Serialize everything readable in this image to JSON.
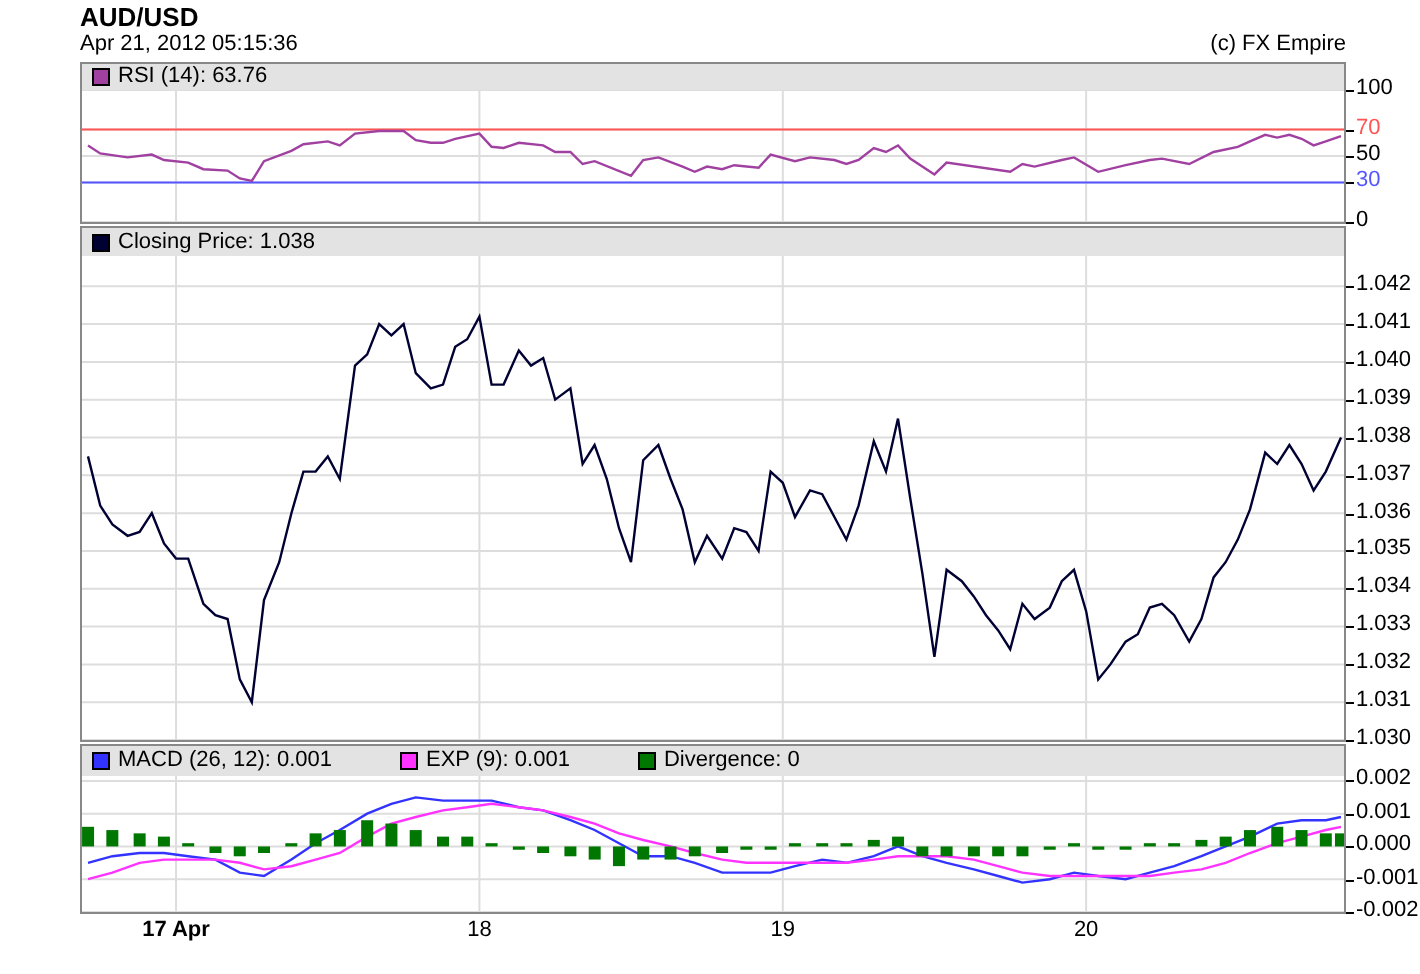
{
  "title": "AUD/USD",
  "timestamp": "Apr 21, 2012 05:15:36",
  "copyright": "(c) FX Empire",
  "panels": [
    {
      "chart_data": {
        "type": "line",
        "xlim": [
          16.69,
          20.85
        ],
        "ylim": [
          0,
          100
        ],
        "yticks": [
          0,
          30,
          50,
          70,
          100
        ],
        "grid": true,
        "legend": "top",
        "ref_lines": [
          {
            "axis": "y",
            "value": 70,
            "color": "#ff5555"
          },
          {
            "axis": "y",
            "value": 30,
            "color": "#5555ff"
          }
        ],
        "x": [
          16.71,
          16.75,
          16.84,
          16.92,
          16.96,
          17.04,
          17.09,
          17.17,
          17.21,
          17.25,
          17.29,
          17.38,
          17.42,
          17.5,
          17.54,
          17.59,
          17.67,
          17.75,
          17.79,
          17.84,
          17.88,
          17.92,
          18.0,
          18.04,
          18.08,
          18.13,
          18.21,
          18.25,
          18.3,
          18.34,
          18.38,
          18.5,
          18.54,
          18.59,
          18.67,
          18.71,
          18.75,
          18.8,
          18.84,
          18.92,
          18.96,
          19.04,
          19.09,
          19.17,
          19.21,
          19.25,
          19.3,
          19.34,
          19.38,
          19.42,
          19.5,
          19.54,
          19.75,
          19.79,
          19.83,
          19.92,
          19.96,
          20.04,
          20.13,
          20.21,
          20.25,
          20.34,
          20.42,
          20.5,
          20.54,
          20.59,
          20.63,
          20.67,
          20.71,
          20.75,
          20.79,
          20.84
        ],
        "series": [
          {
            "name": "RSI (14): 63.76",
            "color": "#a040a0",
            "values": [
              58,
              52,
              49,
              51,
              47,
              45,
              40,
              39,
              33,
              31,
              46,
              54,
              59,
              61,
              58,
              67,
              69,
              69,
              62,
              60,
              60,
              63,
              67,
              57,
              56,
              60,
              58,
              53,
              53,
              44,
              46,
              35,
              47,
              49,
              42,
              38,
              42,
              40,
              43,
              41,
              51,
              46,
              49,
              47,
              44,
              47,
              56,
              53,
              58,
              48,
              36,
              45,
              38,
              44,
              42,
              47,
              49,
              38,
              43,
              47,
              48,
              44,
              53,
              57,
              61,
              66,
              64,
              66,
              63,
              58,
              61,
              65
            ]
          }
        ]
      }
    },
    {
      "chart_data": {
        "type": "line",
        "xlim": [
          16.69,
          20.85
        ],
        "ylim": [
          1.03,
          1.0428
        ],
        "grid": true,
        "legend": "top",
        "yticks": [
          {
            "value": 1.03,
            "label": "1.030"
          },
          {
            "value": 1.031,
            "label": "1.031"
          },
          {
            "value": 1.032,
            "label": "1.032"
          },
          {
            "value": 1.033,
            "label": "1.033"
          },
          {
            "value": 1.034,
            "label": "1.034"
          },
          {
            "value": 1.035,
            "label": "1.035"
          },
          {
            "value": 1.036,
            "label": "1.036"
          },
          {
            "value": 1.037,
            "label": "1.037"
          },
          {
            "value": 1.038,
            "label": "1.038"
          },
          {
            "value": 1.039,
            "label": "1.039"
          },
          {
            "value": 1.04,
            "label": "1.040"
          },
          {
            "value": 1.041,
            "label": "1.041"
          },
          {
            "value": 1.042,
            "label": "1.042"
          }
        ],
        "x": [
          16.71,
          16.75,
          16.79,
          16.84,
          16.88,
          16.92,
          16.96,
          17.0,
          17.04,
          17.09,
          17.13,
          17.17,
          17.21,
          17.25,
          17.29,
          17.34,
          17.38,
          17.42,
          17.46,
          17.5,
          17.54,
          17.59,
          17.63,
          17.67,
          17.71,
          17.75,
          17.79,
          17.84,
          17.88,
          17.92,
          17.96,
          18.0,
          18.04,
          18.08,
          18.13,
          18.17,
          18.21,
          18.25,
          18.3,
          18.34,
          18.38,
          18.42,
          18.46,
          18.5,
          18.54,
          18.59,
          18.63,
          18.67,
          18.71,
          18.75,
          18.8,
          18.84,
          18.88,
          18.92,
          18.96,
          19.0,
          19.04,
          19.09,
          19.13,
          19.17,
          19.21,
          19.25,
          19.3,
          19.34,
          19.38,
          19.42,
          19.46,
          19.5,
          19.54,
          19.59,
          19.63,
          19.67,
          19.71,
          19.75,
          19.79,
          19.83,
          19.88,
          19.92,
          19.96,
          20.0,
          20.04,
          20.08,
          20.13,
          20.17,
          20.21,
          20.25,
          20.29,
          20.34,
          20.38,
          20.42,
          20.46,
          20.5,
          20.54,
          20.59,
          20.63,
          20.67,
          20.71,
          20.75,
          20.79,
          20.84
        ],
        "series": [
          {
            "name": "Closing Price: 1.038",
            "color": "#000033",
            "values": [
              1.0375,
              1.0362,
              1.0357,
              1.0354,
              1.0355,
              1.036,
              1.0352,
              1.0348,
              1.0348,
              1.0336,
              1.0333,
              1.0332,
              1.0316,
              1.031,
              1.0337,
              1.0347,
              1.036,
              1.0371,
              1.0371,
              1.0375,
              1.0369,
              1.0399,
              1.0402,
              1.041,
              1.0407,
              1.041,
              1.0397,
              1.0393,
              1.0394,
              1.0404,
              1.0406,
              1.0412,
              1.0394,
              1.0394,
              1.0403,
              1.0399,
              1.0401,
              1.039,
              1.0393,
              1.0373,
              1.0378,
              1.0369,
              1.0356,
              1.0347,
              1.0374,
              1.0378,
              1.0369,
              1.0361,
              1.0347,
              1.0354,
              1.0348,
              1.0356,
              1.0355,
              1.035,
              1.0371,
              1.0368,
              1.0359,
              1.0366,
              1.0365,
              1.0359,
              1.0353,
              1.0362,
              1.0379,
              1.0371,
              1.0385,
              1.0364,
              1.0344,
              1.0322,
              1.0345,
              1.0342,
              1.0338,
              1.0333,
              1.0329,
              1.0324,
              1.0336,
              1.0332,
              1.0335,
              1.0342,
              1.0345,
              1.0334,
              1.0316,
              1.032,
              1.0326,
              1.0328,
              1.0335,
              1.0336,
              1.0333,
              1.0326,
              1.0332,
              1.0343,
              1.0347,
              1.0353,
              1.0361,
              1.0376,
              1.0373,
              1.0378,
              1.0373,
              1.0366,
              1.0371,
              1.038
            ]
          }
        ]
      }
    },
    {
      "chart_data": {
        "type": "line",
        "xlim": [
          16.69,
          20.85
        ],
        "ylim": [
          -0.002,
          0.00215
        ],
        "grid": true,
        "legend": "top",
        "xticks": [
          {
            "value": 17,
            "label": "17 Apr"
          },
          {
            "value": 18,
            "label": "18"
          },
          {
            "value": 19,
            "label": "19"
          },
          {
            "value": 20,
            "label": "20"
          }
        ],
        "yticks": [
          {
            "value": -0.002,
            "label": "-0.002"
          },
          {
            "value": -0.001,
            "label": "-0.001"
          },
          {
            "value": 0,
            "label": "0.000"
          },
          {
            "value": 0.001,
            "label": "0.001"
          },
          {
            "value": 0.002,
            "label": "0.002"
          }
        ],
        "x": [
          16.71,
          16.79,
          16.88,
          16.96,
          17.04,
          17.13,
          17.21,
          17.29,
          17.38,
          17.46,
          17.54,
          17.63,
          17.71,
          17.79,
          17.88,
          17.96,
          18.04,
          18.13,
          18.21,
          18.3,
          18.38,
          18.46,
          18.54,
          18.63,
          18.71,
          18.8,
          18.88,
          18.96,
          19.04,
          19.13,
          19.21,
          19.3,
          19.38,
          19.46,
          19.54,
          19.63,
          19.71,
          19.79,
          19.88,
          19.96,
          20.04,
          20.13,
          20.21,
          20.29,
          20.38,
          20.46,
          20.54,
          20.63,
          20.71,
          20.79,
          20.84
        ],
        "series": [
          {
            "name": "MACD (26, 12): 0.001",
            "color": "#3333ff",
            "values": [
              -0.0005,
              -0.0003,
              -0.0002,
              -0.0002,
              -0.0003,
              -0.0004,
              -0.0008,
              -0.0009,
              -0.0004,
              0.0001,
              0.0005,
              0.001,
              0.0013,
              0.0015,
              0.0014,
              0.0014,
              0.0014,
              0.0012,
              0.0011,
              0.0008,
              0.0005,
              0.0001,
              -0.0003,
              -0.0003,
              -0.0005,
              -0.0008,
              -0.0008,
              -0.0008,
              -0.0006,
              -0.0004,
              -0.0005,
              -0.0003,
              0,
              -0.0003,
              -0.0005,
              -0.0007,
              -0.0009,
              -0.0011,
              -0.001,
              -0.0008,
              -0.0009,
              -0.001,
              -0.0008,
              -0.0006,
              -0.0003,
              0,
              0.0003,
              0.0007,
              0.0008,
              0.0008,
              0.0009
            ]
          },
          {
            "name": "EXP (9): 0.001",
            "color": "#ff33ff",
            "values": [
              -0.001,
              -0.0008,
              -0.0005,
              -0.0004,
              -0.0004,
              -0.0004,
              -0.0005,
              -0.0007,
              -0.0006,
              -0.0004,
              -0.0002,
              0.0003,
              0.0007,
              0.0009,
              0.0011,
              0.0012,
              0.0013,
              0.0012,
              0.0011,
              0.0009,
              0.0007,
              0.0004,
              0.0002,
              0,
              -0.0002,
              -0.0004,
              -0.0005,
              -0.0005,
              -0.0005,
              -0.0005,
              -0.0005,
              -0.0004,
              -0.0003,
              -0.0003,
              -0.0003,
              -0.0004,
              -0.0006,
              -0.0008,
              -0.0009,
              -0.0009,
              -0.0009,
              -0.0009,
              -0.0009,
              -0.0008,
              -0.0007,
              -0.0005,
              -0.0002,
              0.0001,
              0.0003,
              0.0005,
              0.0006
            ]
          },
          {
            "name": "Divergence: 0",
            "color": "#007700",
            "type": "bar",
            "values": [
              0.0006,
              0.0005,
              0.0004,
              0.0003,
              0.0001,
              -0.0002,
              -0.0003,
              -0.0002,
              0.0001,
              0.0004,
              0.0005,
              0.0008,
              0.0007,
              0.0005,
              0.0003,
              0.0003,
              0.0001,
              -0.0001,
              -0.0002,
              -0.0003,
              -0.0004,
              -0.0006,
              -0.0004,
              -0.0004,
              -0.0003,
              -0.0002,
              -0.0001,
              -0.0001,
              0.0001,
              0.0001,
              0.0001,
              0.0002,
              0.0003,
              -0.0003,
              -0.0003,
              -0.0003,
              -0.0003,
              -0.0003,
              -0.0001,
              0.0001,
              -0.0001,
              -0.0001,
              0.0001,
              0.0001,
              0.0002,
              0.0003,
              0.0005,
              0.0006,
              0.0005,
              0.0004,
              0.0004
            ]
          }
        ]
      }
    }
  ]
}
